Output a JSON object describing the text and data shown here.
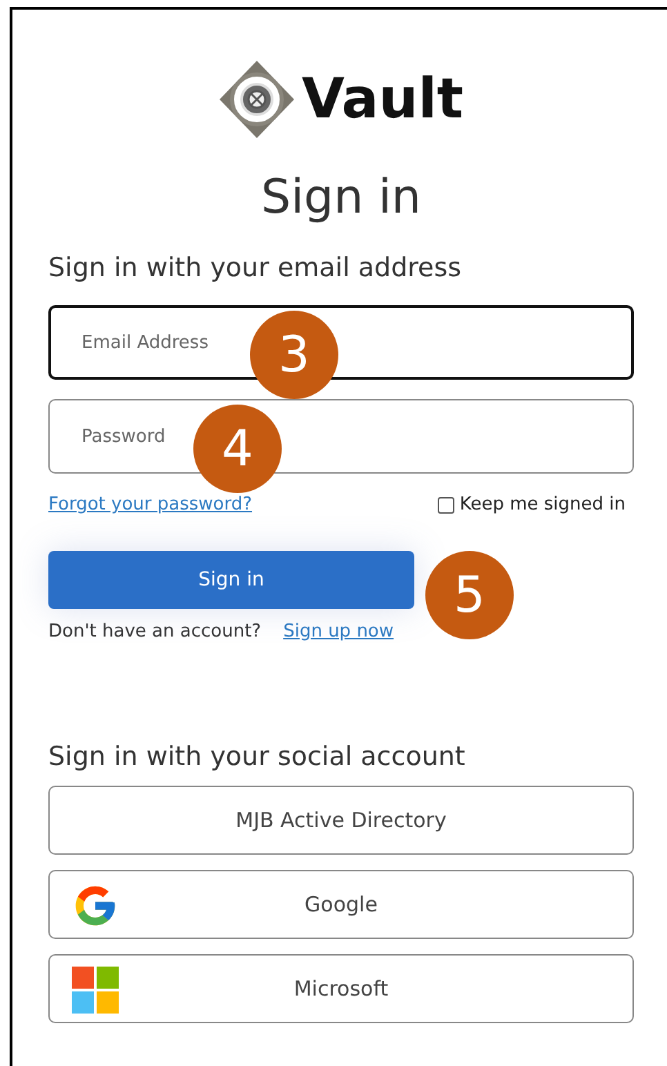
{
  "logo": {
    "text": "Vault"
  },
  "title": "Sign in",
  "local_heading": "Sign in with your email address",
  "fields": [
    {
      "placeholder": "Email Address",
      "focused": true
    },
    {
      "placeholder": "Password",
      "focused": false
    }
  ],
  "forgot_link": "Forgot your password?",
  "keep_signed_in": {
    "label": "Keep me signed in",
    "checked": false
  },
  "sign_in_button": "Sign in",
  "signup_prompt": "Don't have an account?",
  "signup_link": "Sign up now",
  "social_heading": "Sign in with your social account",
  "social_buttons": [
    {
      "label": "MJB Active Directory",
      "kind": "plain"
    },
    {
      "label": "Google",
      "kind": "google"
    },
    {
      "label": "Microsoft",
      "kind": "microsoft"
    }
  ],
  "callouts": [
    {
      "label": "3"
    },
    {
      "label": "4"
    },
    {
      "label": "5"
    }
  ]
}
